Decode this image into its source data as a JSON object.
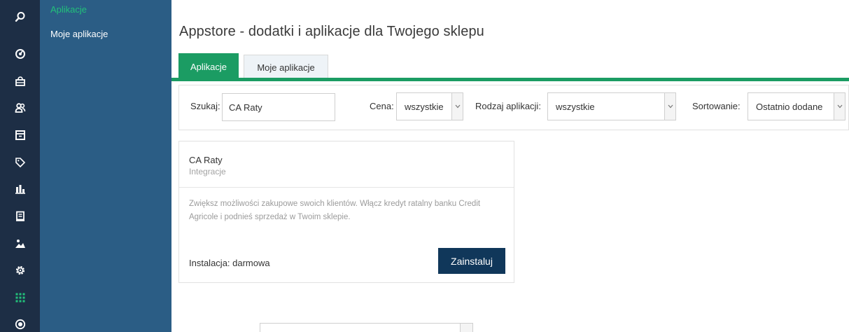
{
  "sidebar": {
    "items": [
      {
        "label": "Aplikacje",
        "active": true
      },
      {
        "label": "Moje aplikacje",
        "active": false
      }
    ]
  },
  "iconbar": [
    "search-icon",
    "dashboard-icon",
    "orders-icon",
    "customers-icon",
    "products-icon",
    "discounts-icon",
    "statistics-icon",
    "content-icon",
    "images-icon",
    "settings-icon",
    "apps-grid-icon",
    "payments-icon"
  ],
  "page": {
    "title": "Appstore - dodatki i aplikacje dla Twojego sklepu"
  },
  "tabs": [
    {
      "label": "Aplikacje",
      "active": true
    },
    {
      "label": "Moje aplikacje",
      "active": false
    }
  ],
  "filters": {
    "search_label": "Szukaj:",
    "search_value": "CA Raty",
    "price_label": "Cena:",
    "price_value": "wszystkie",
    "type_label": "Rodzaj aplikacji:",
    "type_value": "wszystkie",
    "sort_label": "Sortowanie:",
    "sort_value": "Ostatnio dodane"
  },
  "app_card": {
    "name": "CA Raty",
    "category": "Integracje",
    "description": "Zwiększ możliwości zakupowe swoich klientów. Włącz kredyt ratalny banku Credit Agricole i podnieś sprzedaż w Twoim sklepie.",
    "price": "Instalacja: darmowa",
    "install_label": "Zainstaluj"
  },
  "colors": {
    "iconbar_bg": "#1d2e45",
    "subnav_bg": "#2b5d85",
    "accent_green": "#1b9c63",
    "active_link": "#22c17a",
    "install_button": "#10375a"
  }
}
